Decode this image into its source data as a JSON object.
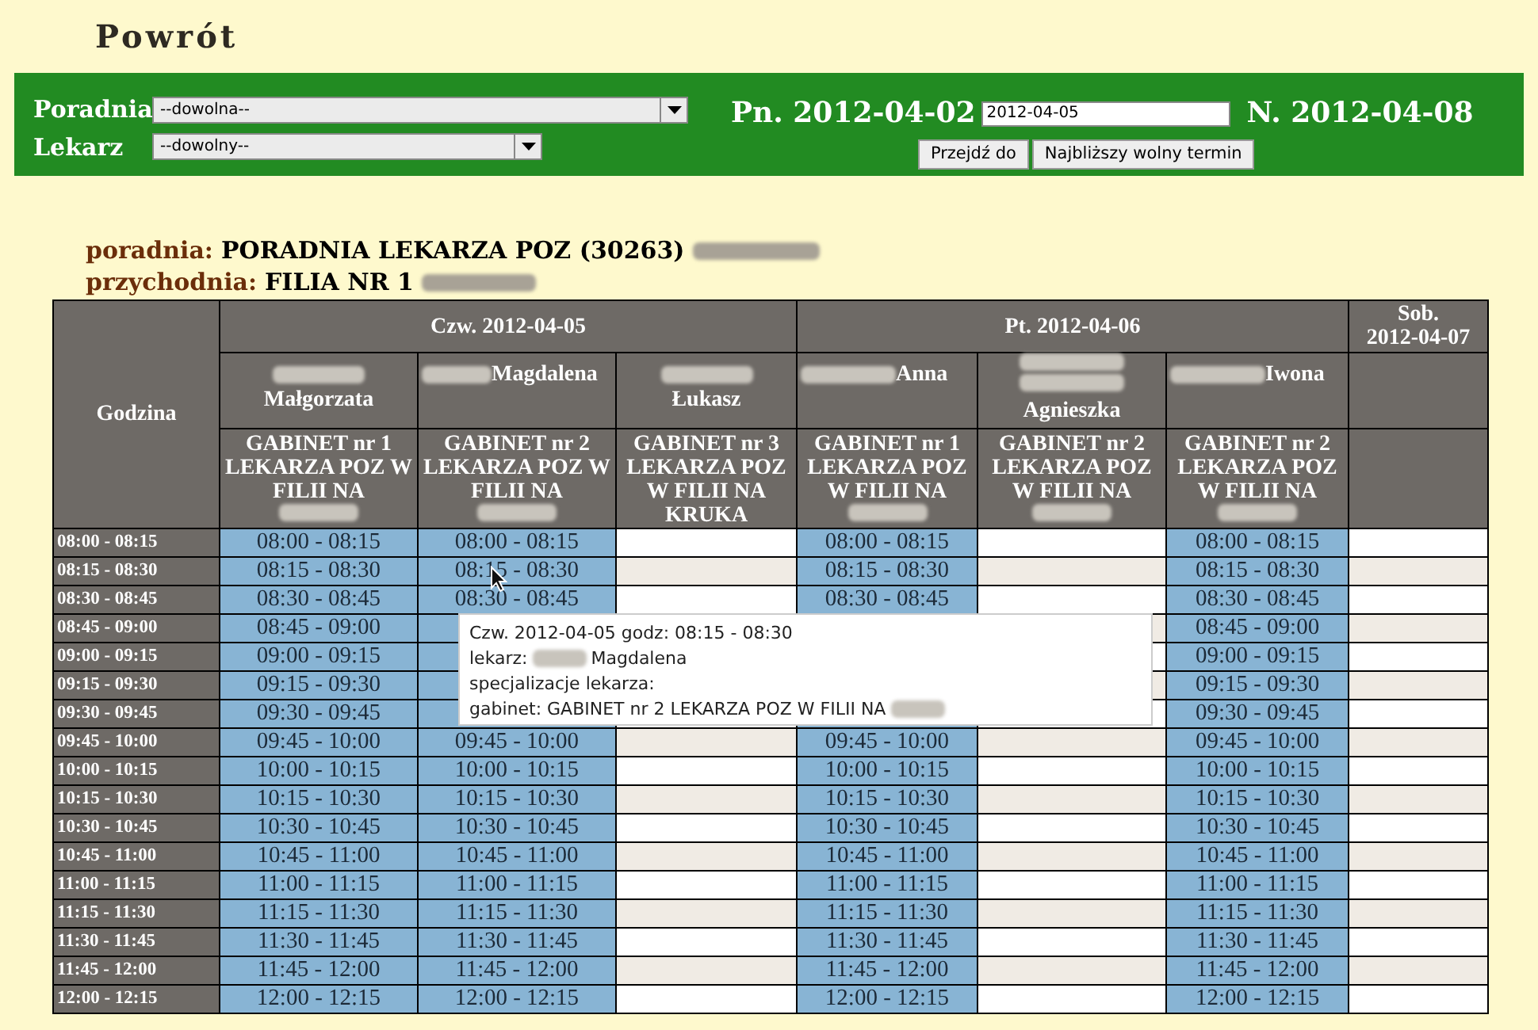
{
  "back_link": "Powrót",
  "filters": [
    {
      "label": "Poradnia",
      "value": "--dowolna--",
      "kind": "wide"
    },
    {
      "label": "Lekarz",
      "value": "--dowolny--",
      "kind": "narrow"
    }
  ],
  "week": {
    "start": "Pn. 2012-04-02",
    "date_value": "2012-04-05",
    "end": "N. 2012-04-08",
    "buttons": [
      "Przejdź do",
      "Najbliższy wolny termin"
    ]
  },
  "info": [
    {
      "label": "poradnia:",
      "value": "PORADNIA LEKARZA POZ (30263)",
      "redacted": true
    },
    {
      "label": "przychodnia:",
      "value": "FILIA NR 1",
      "redacted": true
    }
  ],
  "table": {
    "time_header": "Godzina",
    "days": [
      {
        "label": "Czw. 2012-04-05",
        "columns": [
          {
            "kind": "doctor",
            "doctor": {
              "kind": "above",
              "name": "Małgorzata",
              "redacted": true
            },
            "room": "GABINET nr 1 LEKARZA POZ W FILII NA",
            "room_redacted": true
          },
          {
            "kind": "doctor",
            "doctor": {
              "kind": "inline",
              "name": "Magdalena",
              "redacted": true
            },
            "room": "GABINET nr 2 LEKARZA POZ W FILII NA",
            "room_redacted": true
          },
          {
            "kind": "doctor",
            "doctor": {
              "kind": "above",
              "name": "Łukasz",
              "redacted": true
            },
            "room": "GABINET nr 3 LEKARZA POZ W FILII NA KRUKA"
          }
        ]
      },
      {
        "label": "Pt. 2012-04-06",
        "columns": [
          {
            "kind": "doctor",
            "doctor": {
              "kind": "inline",
              "name": "Anna",
              "redacted": true
            },
            "room": "GABINET nr 1 LEKARZA POZ W FILII NA",
            "room_redacted": true
          },
          {
            "kind": "doctor",
            "doctor": {
              "kind": "double",
              "name": "Agnieszka",
              "redacted": true
            },
            "room": "GABINET nr 2 LEKARZA POZ W FILII NA",
            "room_redacted": true
          },
          {
            "kind": "doctor",
            "doctor": {
              "kind": "inline",
              "name": "Iwona",
              "redacted": true
            },
            "room": "GABINET nr 2 LEKARZA POZ W FILII NA",
            "room_redacted": true
          }
        ]
      },
      {
        "label": "Sob. 2012-04-07",
        "columns": [
          {
            "kind": "blank"
          }
        ]
      }
    ],
    "rows": [
      {
        "time": "08:00 - 08:15",
        "cells": [
          {
            "kind": "slot",
            "text": "08:00 - 08:15"
          },
          {
            "kind": "slot",
            "text": "08:00 - 08:15"
          },
          {
            "kind": "empty"
          },
          {
            "kind": "slot",
            "text": "08:00 - 08:15"
          },
          {
            "kind": "empty"
          },
          {
            "kind": "slot",
            "text": "08:00 - 08:15"
          },
          {
            "kind": "empty"
          }
        ]
      },
      {
        "time": "08:15 - 08:30",
        "cells": [
          {
            "kind": "slot",
            "text": "08:15 - 08:30"
          },
          {
            "kind": "slot",
            "text": "08:15 - 08:30"
          },
          {
            "kind": "empty"
          },
          {
            "kind": "slot",
            "text": "08:15 - 08:30"
          },
          {
            "kind": "empty"
          },
          {
            "kind": "slot",
            "text": "08:15 - 08:30"
          },
          {
            "kind": "empty"
          }
        ]
      },
      {
        "time": "08:30 - 08:45",
        "cells": [
          {
            "kind": "slot",
            "text": "08:30 - 08:45"
          },
          {
            "kind": "slot",
            "text": "08:30 - 08:45"
          },
          {
            "kind": "empty"
          },
          {
            "kind": "slot",
            "text": "08:30 - 08:45"
          },
          {
            "kind": "empty"
          },
          {
            "kind": "slot",
            "text": "08:30 - 08:45"
          },
          {
            "kind": "empty"
          }
        ]
      },
      {
        "time": "08:45 - 09:00",
        "cells": [
          {
            "kind": "slot",
            "text": "08:45 - 09:00"
          },
          {
            "kind": "slot"
          },
          {
            "kind": "empty"
          },
          {
            "kind": "slot"
          },
          {
            "kind": "empty"
          },
          {
            "kind": "slot",
            "text": "08:45 - 09:00"
          },
          {
            "kind": "empty"
          }
        ]
      },
      {
        "time": "09:00 - 09:15",
        "cells": [
          {
            "kind": "slot",
            "text": "09:00 - 09:15"
          },
          {
            "kind": "slot"
          },
          {
            "kind": "empty"
          },
          {
            "kind": "slot"
          },
          {
            "kind": "empty"
          },
          {
            "kind": "slot",
            "text": "09:00 - 09:15"
          },
          {
            "kind": "empty"
          }
        ]
      },
      {
        "time": "09:15 - 09:30",
        "cells": [
          {
            "kind": "slot",
            "text": "09:15 - 09:30"
          },
          {
            "kind": "slot"
          },
          {
            "kind": "empty"
          },
          {
            "kind": "slot"
          },
          {
            "kind": "empty"
          },
          {
            "kind": "slot",
            "text": "09:15 - 09:30"
          },
          {
            "kind": "empty"
          }
        ]
      },
      {
        "time": "09:30 - 09:45",
        "cells": [
          {
            "kind": "slot",
            "text": "09:30 - 09:45"
          },
          {
            "kind": "slot"
          },
          {
            "kind": "empty"
          },
          {
            "kind": "slot"
          },
          {
            "kind": "empty"
          },
          {
            "kind": "slot",
            "text": "09:30 - 09:45"
          },
          {
            "kind": "empty"
          }
        ]
      },
      {
        "time": "09:45 - 10:00",
        "cells": [
          {
            "kind": "slot",
            "text": "09:45 - 10:00"
          },
          {
            "kind": "slot",
            "text": "09:45 - 10:00"
          },
          {
            "kind": "empty"
          },
          {
            "kind": "slot",
            "text": "09:45 - 10:00"
          },
          {
            "kind": "empty"
          },
          {
            "kind": "slot",
            "text": "09:45 - 10:00"
          },
          {
            "kind": "empty"
          }
        ]
      },
      {
        "time": "10:00 - 10:15",
        "cells": [
          {
            "kind": "slot",
            "text": "10:00 - 10:15"
          },
          {
            "kind": "slot",
            "text": "10:00 - 10:15"
          },
          {
            "kind": "empty"
          },
          {
            "kind": "slot",
            "text": "10:00 - 10:15"
          },
          {
            "kind": "empty"
          },
          {
            "kind": "slot",
            "text": "10:00 - 10:15"
          },
          {
            "kind": "empty"
          }
        ]
      },
      {
        "time": "10:15 - 10:30",
        "cells": [
          {
            "kind": "slot",
            "text": "10:15 - 10:30"
          },
          {
            "kind": "slot",
            "text": "10:15 - 10:30"
          },
          {
            "kind": "empty"
          },
          {
            "kind": "slot",
            "text": "10:15 - 10:30"
          },
          {
            "kind": "empty"
          },
          {
            "kind": "slot",
            "text": "10:15 - 10:30"
          },
          {
            "kind": "empty"
          }
        ]
      },
      {
        "time": "10:30 - 10:45",
        "cells": [
          {
            "kind": "slot",
            "text": "10:30 - 10:45"
          },
          {
            "kind": "slot",
            "text": "10:30 - 10:45"
          },
          {
            "kind": "empty"
          },
          {
            "kind": "slot",
            "text": "10:30 - 10:45"
          },
          {
            "kind": "empty"
          },
          {
            "kind": "slot",
            "text": "10:30 - 10:45"
          },
          {
            "kind": "empty"
          }
        ]
      },
      {
        "time": "10:45 - 11:00",
        "cells": [
          {
            "kind": "slot",
            "text": "10:45 - 11:00"
          },
          {
            "kind": "slot",
            "text": "10:45 - 11:00"
          },
          {
            "kind": "empty"
          },
          {
            "kind": "slot",
            "text": "10:45 - 11:00"
          },
          {
            "kind": "empty"
          },
          {
            "kind": "slot",
            "text": "10:45 - 11:00"
          },
          {
            "kind": "empty"
          }
        ]
      },
      {
        "time": "11:00 - 11:15",
        "cells": [
          {
            "kind": "slot",
            "text": "11:00 - 11:15"
          },
          {
            "kind": "slot",
            "text": "11:00 - 11:15"
          },
          {
            "kind": "empty"
          },
          {
            "kind": "slot",
            "text": "11:00 - 11:15"
          },
          {
            "kind": "empty"
          },
          {
            "kind": "slot",
            "text": "11:00 - 11:15"
          },
          {
            "kind": "empty"
          }
        ]
      },
      {
        "time": "11:15 - 11:30",
        "cells": [
          {
            "kind": "slot",
            "text": "11:15 - 11:30"
          },
          {
            "kind": "slot",
            "text": "11:15 - 11:30"
          },
          {
            "kind": "empty"
          },
          {
            "kind": "slot",
            "text": "11:15 - 11:30"
          },
          {
            "kind": "empty"
          },
          {
            "kind": "slot",
            "text": "11:15 - 11:30"
          },
          {
            "kind": "empty"
          }
        ]
      },
      {
        "time": "11:30 - 11:45",
        "cells": [
          {
            "kind": "slot",
            "text": "11:30 - 11:45"
          },
          {
            "kind": "slot",
            "text": "11:30 - 11:45"
          },
          {
            "kind": "empty"
          },
          {
            "kind": "slot",
            "text": "11:30 - 11:45"
          },
          {
            "kind": "empty"
          },
          {
            "kind": "slot",
            "text": "11:30 - 11:45"
          },
          {
            "kind": "empty"
          }
        ]
      },
      {
        "time": "11:45 - 12:00",
        "cells": [
          {
            "kind": "slot",
            "text": "11:45 - 12:00"
          },
          {
            "kind": "slot",
            "text": "11:45 - 12:00"
          },
          {
            "kind": "empty"
          },
          {
            "kind": "slot",
            "text": "11:45 - 12:00"
          },
          {
            "kind": "empty"
          },
          {
            "kind": "slot",
            "text": "11:45 - 12:00"
          },
          {
            "kind": "empty"
          }
        ]
      },
      {
        "time": "12:00 - 12:15",
        "cells": [
          {
            "kind": "slot",
            "text": "12:00 - 12:15"
          },
          {
            "kind": "slot",
            "text": "12:00 - 12:15"
          },
          {
            "kind": "empty"
          },
          {
            "kind": "slot",
            "text": "12:00 - 12:15"
          },
          {
            "kind": "empty"
          },
          {
            "kind": "slot",
            "text": "12:00 - 12:15"
          },
          {
            "kind": "empty"
          }
        ]
      }
    ]
  },
  "tooltip": {
    "lines": [
      {
        "text": "Czw. 2012-04-05 godz: 08:15 - 08:30"
      },
      {
        "text": "lekarz:",
        "redacted": true,
        "after": "Magdalena"
      },
      {
        "text": "specjalizacje lekarza:"
      },
      {
        "text": "gabinet: GABINET nr 2 LEKARZA POZ W FILII NA",
        "redacted": true
      }
    ]
  }
}
